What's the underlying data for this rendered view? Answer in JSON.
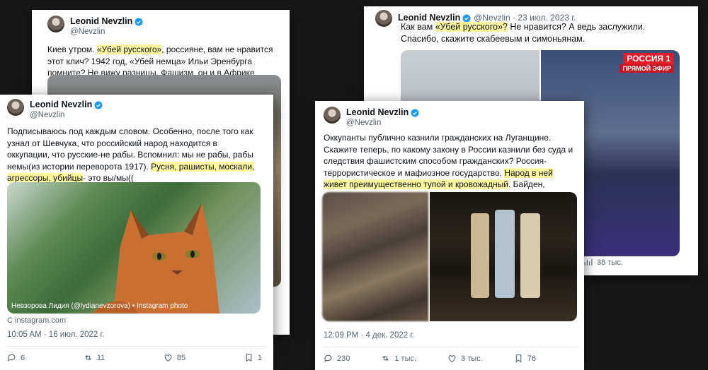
{
  "author": {
    "name": "Leonid Nevzlin",
    "handle": "@Nevzlin"
  },
  "tweet_top_left": {
    "text_1": "Киев утром. ",
    "highlight": "«Убей русского»",
    "text_2": ", россияне, вам не нравится этот клич? 1942 год, «Убей немца» Ильи Эренбурга помните? Не вижу разницы. Фашизм, он и в Африке фашизм. Рашизм, сорри, теперь ",
    "emoji": "😭 🇷🇺 😭"
  },
  "tweet_cat": {
    "text_1": "Подписываюсь под каждым словом. Особенно, после того как узнал от Шевчука, что российский народ находится в оккупации, что русские-не рабы. Вспомнил: мы не рабы, рабы немы(из истории переворота 1917). ",
    "highlight": "Русня, рашисты, москали, агрессоры, убийцы",
    "text_2": "- это вы/мы((",
    "photo_caption": "Невзорова Лидия (@lydianevzorova) • Instagram photo",
    "link_source": "C instagram.com",
    "timestamp": "10:05 AM · 16 июл. 2022 г.",
    "replies": "6",
    "retweets": "11",
    "likes": "85",
    "bookmarks": "1"
  },
  "tweet_center": {
    "text_1": "Оккупанты публично казнили гражданских на Луганщине. Скажите теперь, по какому закону в России казнили без суда и следствия фашистским способом гражданских? Россия- террористическое и мафиозное государство. ",
    "highlight": "Народ в ней живет преимущественно тупой и кровожадный",
    "text_2": ". Байден, проснись!",
    "timestamp": "12:09 PM · 4 дек. 2022 г.",
    "replies": "230",
    "retweets": "1 тыс.",
    "likes": "3 тыс.",
    "bookmarks": "76"
  },
  "tweet_right": {
    "date": "@Nevzlin · 23 июл. 2023 г.",
    "text_1": "Как вам ",
    "highlight": "«Убей русского»?",
    "text_2": " Не нравится? А ведь заслужили. Спасибо, скажите скабеевым и симоньянам.",
    "tv_channel": "РОССИЯ 1",
    "tv_live": "ПРЯМОЙ ЭФИР",
    "views": "38 тыс."
  },
  "colors": {
    "highlight": "#fff7a0",
    "verified": "#1d9bf0",
    "muted": "#536471"
  }
}
